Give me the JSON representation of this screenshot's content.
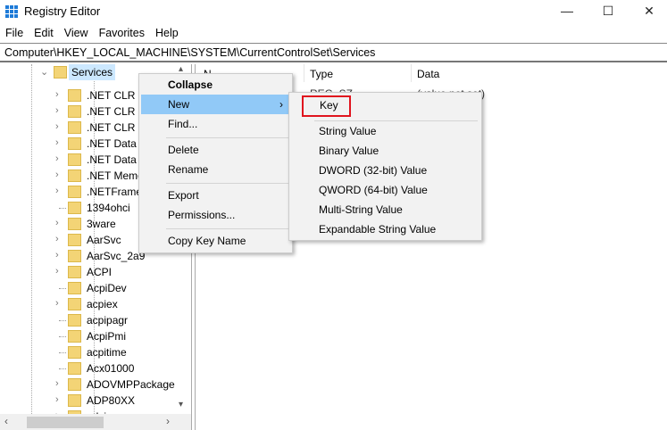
{
  "window": {
    "title": "Registry Editor",
    "minimize": "—",
    "maximize": "☐",
    "close": "✕"
  },
  "menubar": [
    "File",
    "Edit",
    "View",
    "Favorites",
    "Help"
  ],
  "address": "Computer\\HKEY_LOCAL_MACHINE\\SYSTEM\\CurrentControlSet\\Services",
  "tree": {
    "selected": "Services",
    "items": [
      {
        "label": ".NET CLR D",
        "expandable": true
      },
      {
        "label": ".NET CLR N",
        "expandable": true
      },
      {
        "label": ".NET CLR N",
        "expandable": true
      },
      {
        "label": ".NET Data P",
        "expandable": true
      },
      {
        "label": ".NET Data P",
        "expandable": true
      },
      {
        "label": ".NET Memo",
        "expandable": true
      },
      {
        "label": ".NETFrame",
        "expandable": true
      },
      {
        "label": "1394ohci",
        "expandable": false
      },
      {
        "label": "3ware",
        "expandable": true
      },
      {
        "label": "AarSvc",
        "expandable": true
      },
      {
        "label": "AarSvc_2a9",
        "expandable": true
      },
      {
        "label": "ACPI",
        "expandable": true
      },
      {
        "label": "AcpiDev",
        "expandable": false
      },
      {
        "label": "acpiex",
        "expandable": true
      },
      {
        "label": "acpipagr",
        "expandable": false
      },
      {
        "label": "AcpiPmi",
        "expandable": false
      },
      {
        "label": "acpitime",
        "expandable": false
      },
      {
        "label": "Acx01000",
        "expandable": false
      },
      {
        "label": "ADOVMPPackage",
        "expandable": true
      },
      {
        "label": "ADP80XX",
        "expandable": true
      },
      {
        "label": "adsi",
        "expandable": true
      }
    ]
  },
  "values": {
    "headers": {
      "name": "N",
      "type": "Type",
      "data": "Data"
    },
    "row": {
      "type": "REG_SZ",
      "data": "(value not set)"
    }
  },
  "context_menu": {
    "items": [
      "Collapse",
      "New",
      "Find...",
      "Delete",
      "Rename",
      "Export",
      "Permissions...",
      "Copy Key Name"
    ],
    "highlighted": "New"
  },
  "submenu": {
    "items": [
      "Key",
      "String Value",
      "Binary Value",
      "DWORD (32-bit) Value",
      "QWORD (64-bit) Value",
      "Multi-String Value",
      "Expandable String Value"
    ],
    "highlight_box_color": "#e0141e"
  },
  "colors": {
    "selection": "#cce8ff",
    "menu_highlight": "#91c9f7",
    "folder": "#f3d476"
  }
}
